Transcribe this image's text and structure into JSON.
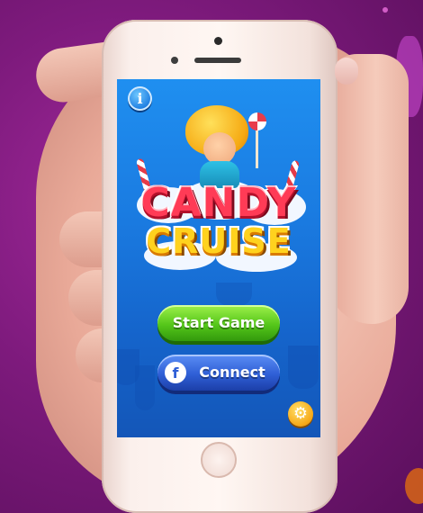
{
  "game": {
    "logo_line1": "CANDY",
    "logo_line2": "CRUISE"
  },
  "buttons": {
    "info_label": "i",
    "start_label": "Start Game",
    "connect_label": "Connect",
    "facebook_glyph": "f",
    "settings_glyph": "⚙"
  },
  "icons": {
    "info": "info-icon",
    "facebook": "facebook-icon",
    "settings": "gear-icon"
  },
  "colors": {
    "background": "#7d1a7c",
    "screen_blue": "#1a7ae0",
    "start_green": "#55c61a",
    "connect_blue": "#2f5fd6",
    "settings_orange": "#f6a716",
    "logo_red": "#ff3b56",
    "logo_yellow": "#ffd21e"
  }
}
